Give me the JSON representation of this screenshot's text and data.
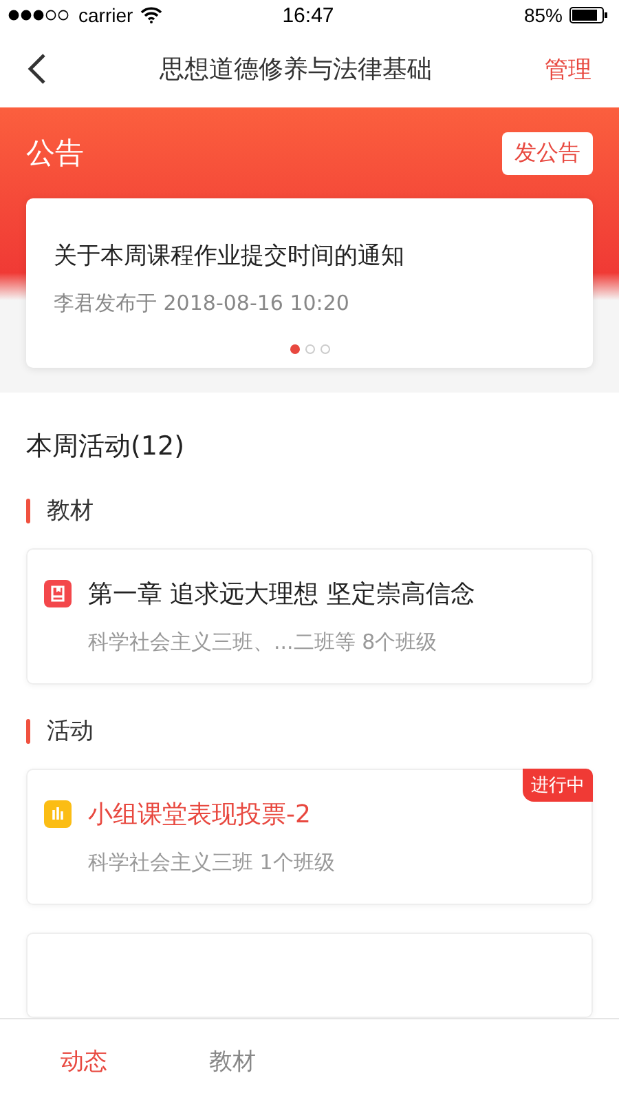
{
  "status_bar": {
    "carrier": "carrier",
    "time": "16:47",
    "battery": "85%"
  },
  "nav": {
    "title": "思想道德修养与法律基础",
    "action": "管理"
  },
  "announcement": {
    "heading": "公告",
    "button": "发公告",
    "title": "关于本周课程作业提交时间的通知",
    "meta": "李君发布于 2018-08-16 10:20",
    "pages": [
      {
        "selected": true
      },
      {
        "selected": false
      },
      {
        "selected": false
      }
    ]
  },
  "activities_heading": "本周活动(12)",
  "sections": [
    {
      "label": "教材",
      "items": [
        {
          "kind": "textbook",
          "title": "第一章 追求远大理想 坚定崇高信念",
          "subtitle": "科学社会主义三班、...二班等 8个班级"
        }
      ]
    },
    {
      "label": "活动",
      "items": [
        {
          "kind": "vote",
          "title": "小组课堂表现投票-2",
          "subtitle": "科学社会主义三班 1个班级",
          "badge": "进行中"
        }
      ]
    }
  ],
  "tabs": [
    {
      "label": "动态",
      "selected": true
    },
    {
      "label": "教材",
      "selected": false
    }
  ]
}
